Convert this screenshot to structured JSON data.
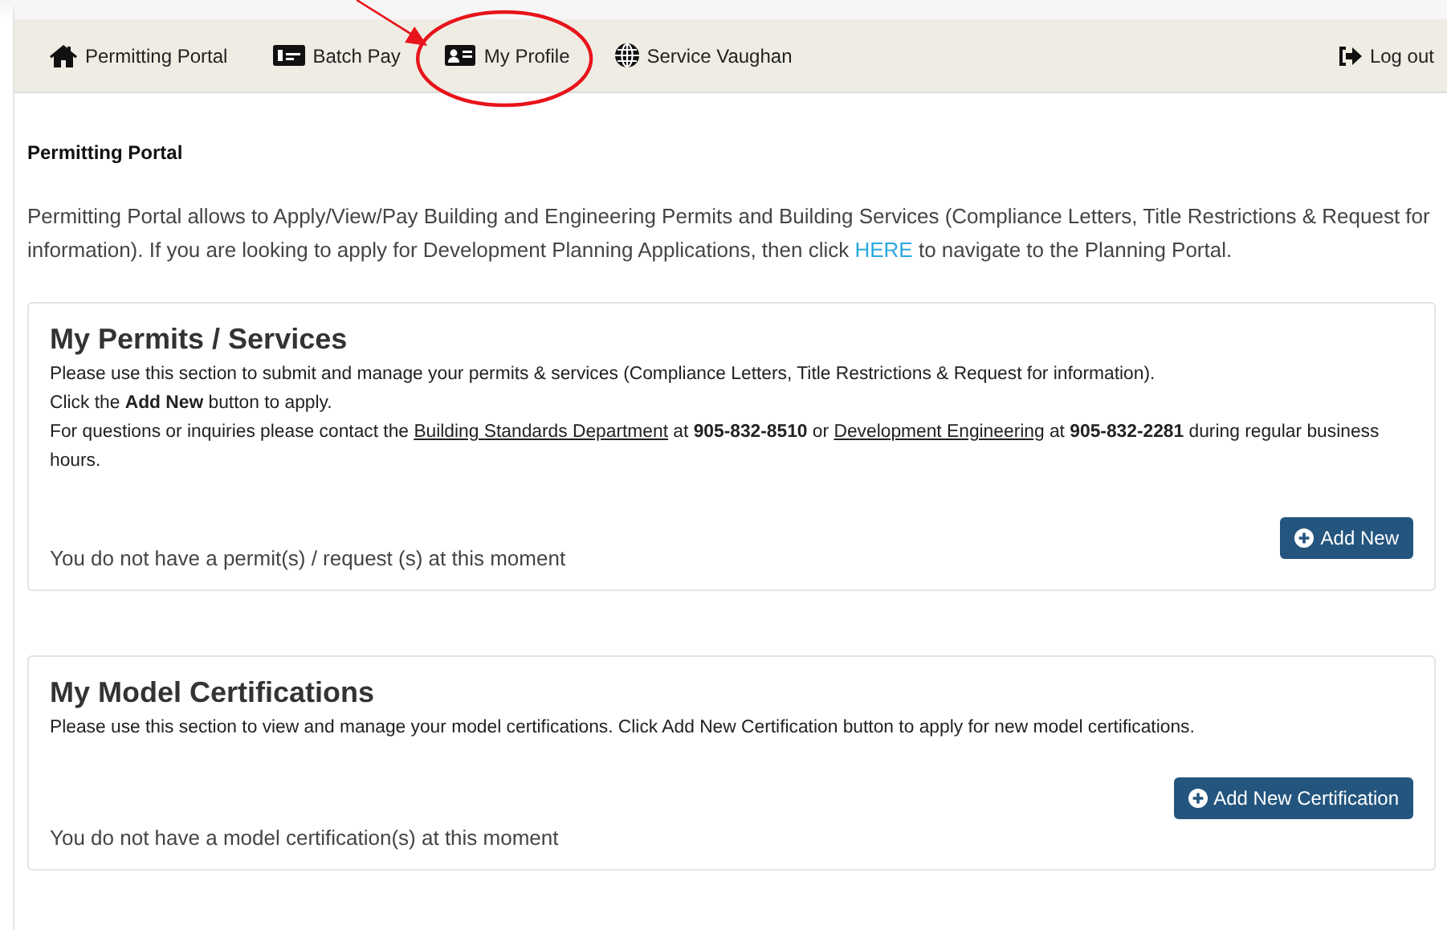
{
  "nav": {
    "items": [
      {
        "label": "Permitting Portal",
        "kind": "home",
        "highlighted": false
      },
      {
        "label": "Batch Pay",
        "kind": "card",
        "highlighted": false
      },
      {
        "label": "My Profile",
        "kind": "id",
        "highlighted": true
      },
      {
        "label": "Service Vaughan",
        "kind": "globe",
        "highlighted": false
      }
    ],
    "logout": {
      "label": "Log out"
    }
  },
  "page_title": "Permitting Portal",
  "intro": [
    {
      "kind": "text",
      "text": "Permitting Portal allows to Apply/View/Pay Building and Engineering Permits and Building Services (Compliance Letters, Title Restrictions & Request for information). If you are looking to apply for Development Planning Applications, then click "
    },
    {
      "kind": "link",
      "text": "HERE"
    },
    {
      "kind": "text",
      "text": " to navigate to the Planning Portal."
    }
  ],
  "sections": [
    {
      "title": "My Permits / Services",
      "lines": [
        [
          {
            "kind": "text",
            "text": "Please use this section to submit and manage your permits & services (Compliance Letters, Title Restrictions & Request for information)."
          }
        ],
        [
          {
            "kind": "text",
            "text": "Click the "
          },
          {
            "kind": "bold",
            "text": "Add New"
          },
          {
            "kind": "text",
            "text": " button to apply."
          }
        ],
        [
          {
            "kind": "text",
            "text": "For questions or inquiries please contact the "
          },
          {
            "kind": "link",
            "text": "Building Standards Department"
          },
          {
            "kind": "text",
            "text": " at "
          },
          {
            "kind": "bold",
            "text": "905-832-8510"
          },
          {
            "kind": "text",
            "text": " or "
          },
          {
            "kind": "link",
            "text": "Development Engineering"
          },
          {
            "kind": "text",
            "text": " at "
          },
          {
            "kind": "bold",
            "text": "905-832-2281"
          },
          {
            "kind": "text",
            "text": " during regular business hours."
          }
        ]
      ],
      "button": "Add New",
      "empty": "You do not have a permit(s) / request (s) at this moment"
    },
    {
      "title": "My Model Certifications",
      "lines": [
        [
          {
            "kind": "text",
            "text": "Please use this section to view and manage your model certifications. Click Add New Certification button to apply for new model certifications."
          }
        ]
      ],
      "button": "Add New Certification",
      "empty": "You do not have a model certification(s) at this moment"
    }
  ]
}
